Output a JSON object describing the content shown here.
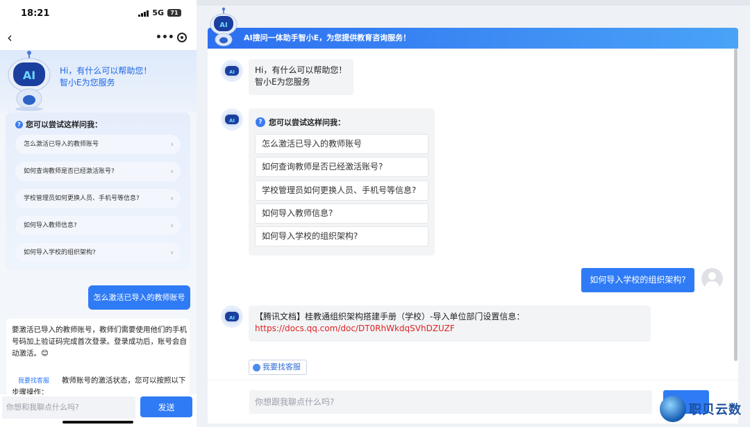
{
  "mobile": {
    "status": {
      "time": "18:21",
      "network": "5G",
      "battery": "71"
    },
    "nav": {
      "back": "‹",
      "more": "•••"
    },
    "greeting": {
      "line1": "Hi，有什么可以帮助您！",
      "line2": "智小E为您服务"
    },
    "suggest_title": "您可以尝试这样问我：",
    "suggestions": [
      "怎么激活已导入的教师账号",
      "如何查询教师是否已经激活账号?",
      "学校管理员如何更换人员、手机号等信息?",
      "如何导入教师信息?",
      "如何导入学校的组织架构?"
    ],
    "user_message": "怎么激活已导入的教师账号",
    "bot_answer": "要激活已导入的教师账号，教师们需要使用他们的手机号码加上验证码完成首次登录。登录成功后，账号会自动激活。😊",
    "bot_answer_tail": "教师账号的激活状态，您可以按照以下",
    "bot_answer_tail2": "步骤操作：",
    "cs_link": "我要找客服",
    "input_placeholder": "你想和我聊点什么吗?",
    "send_label": "发送"
  },
  "desktop": {
    "header_title": "AI搜问一体助手智小E，为您提供教育咨询服务！",
    "robot_badge": "AI",
    "greeting": {
      "line1": "Hi，有什么可以帮助您！",
      "line2": "智小E为您服务"
    },
    "suggest_title": "您可以尝试这样问我：",
    "suggestions": [
      "怎么激活已导入的教师账号",
      "如何查询教师是否已经激活账号?",
      "学校管理员如何更换人员、手机号等信息?",
      "如何导入教师信息?",
      "如何导入学校的组织架构?"
    ],
    "user_message": "如何导入学校的组织架构?",
    "bot_reply_text": "【腾讯文档】桂教通组织架构搭建手册（学校）-导入单位部门设置信息：",
    "bot_reply_link": "https://docs.qq.com/doc/DT0RhWkdqSVhDZUZF",
    "cs_button": "我要找客服",
    "input_placeholder": "你想跟我聊点什么吗?"
  },
  "watermark": "职贝云数",
  "colors": {
    "accent": "#2f7bf5",
    "link": "#dd2222"
  }
}
